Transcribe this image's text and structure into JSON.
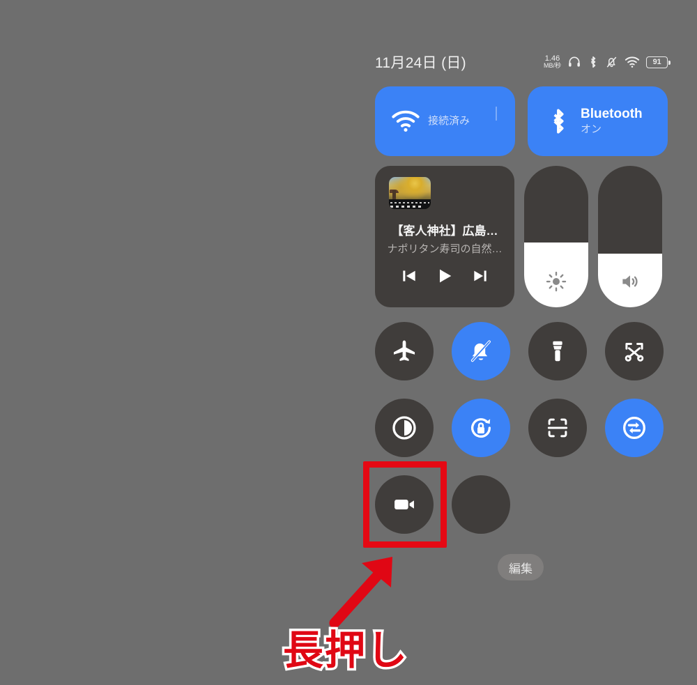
{
  "statusbar": {
    "date": "11月24日 (日)",
    "net_speed_value": "1.46",
    "net_speed_unit": "MB/秒",
    "icons": [
      "headphones-icon",
      "bluetooth-icon",
      "bell-muted-icon",
      "wifi-icon"
    ],
    "battery_percent": "91"
  },
  "connectivity": {
    "wifi": {
      "title": "",
      "subtitle": "接続済み",
      "state": "on"
    },
    "bluetooth": {
      "title": "Bluetooth",
      "subtitle": "オン",
      "state": "on"
    }
  },
  "media": {
    "title": "【客人神社】広島…",
    "subtitle": "ナポリタン寿司の自然…",
    "controls": {
      "previous": "previous-track",
      "play": "play",
      "next": "next-track"
    }
  },
  "sliders": {
    "brightness": {
      "name": "brightness",
      "level_percent": 46
    },
    "volume": {
      "name": "volume",
      "level_percent": 38
    }
  },
  "toggles": [
    {
      "id": "airplane-mode",
      "icon": "airplane-icon",
      "state": "off"
    },
    {
      "id": "silent-mode",
      "icon": "bell-muted-icon",
      "state": "on"
    },
    {
      "id": "flashlight",
      "icon": "flashlight-icon",
      "state": "off"
    },
    {
      "id": "screenshot",
      "icon": "scissors-crop-icon",
      "state": "off"
    },
    {
      "id": "dark-mode",
      "icon": "contrast-circle-icon",
      "state": "off"
    },
    {
      "id": "rotation-lock",
      "icon": "rotation-lock-icon",
      "state": "on"
    },
    {
      "id": "scan-code",
      "icon": "scan-frame-icon",
      "state": "off"
    },
    {
      "id": "data-sync",
      "icon": "sync-arrows-icon",
      "state": "on"
    },
    {
      "id": "screen-recorder",
      "icon": "video-camera-icon",
      "state": "off"
    },
    {
      "id": "empty-slot",
      "icon": "",
      "state": "off"
    }
  ],
  "edit_button": {
    "label": "編集"
  },
  "annotation": {
    "caption": "長押し",
    "highlight_target": "screen-recorder",
    "arrow": "arrow-up-right",
    "accent_color": "#e00714"
  },
  "colors": {
    "background": "#6e6e6e",
    "tile_off": "#403d3b",
    "tile_on": "#3b82f6",
    "slider_fill": "#ffffff",
    "annotation_red": "#e00714"
  }
}
